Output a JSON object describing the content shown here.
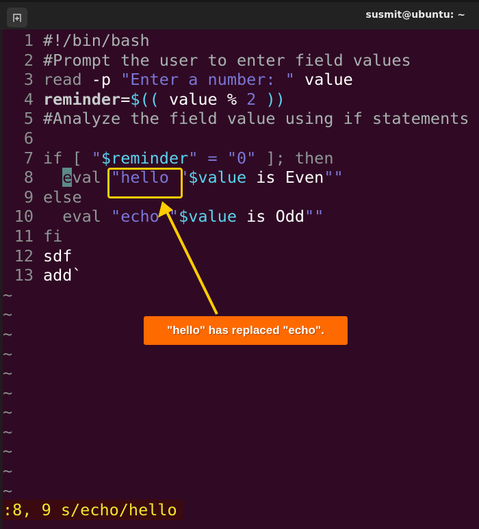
{
  "window": {
    "title": "susmit@ubuntu: ~",
    "new_tab_icon": "new-tab-icon"
  },
  "editor": {
    "lines": [
      {
        "n": "1",
        "segments": [
          {
            "t": "#!/bin/bash",
            "c": "comment"
          }
        ]
      },
      {
        "n": "2",
        "segments": [
          {
            "t": "#Prompt the user to enter field values",
            "c": "comment"
          }
        ]
      },
      {
        "n": "3",
        "segments": [
          {
            "t": "read ",
            "c": "kw"
          },
          {
            "t": "-p ",
            "c": "plain"
          },
          {
            "t": "\"Enter a number: \"",
            "c": "str"
          },
          {
            "t": " value",
            "c": "plain"
          }
        ]
      },
      {
        "n": "4",
        "segments": [
          {
            "t": "reminder",
            "c": "bold"
          },
          {
            "t": "=",
            "c": "op"
          },
          {
            "t": "$((",
            "c": "var"
          },
          {
            "t": " value % ",
            "c": "plain"
          },
          {
            "t": "2",
            "c": "num"
          },
          {
            "t": " ))",
            "c": "var"
          }
        ]
      },
      {
        "n": "5",
        "segments": [
          {
            "t": "#Analyze the field value using if statements",
            "c": "comment"
          }
        ]
      },
      {
        "n": "6",
        "segments": []
      },
      {
        "n": "7",
        "segments": [
          {
            "t": "if [ ",
            "c": "kw"
          },
          {
            "t": "\"",
            "c": "str"
          },
          {
            "t": "$reminder",
            "c": "var"
          },
          {
            "t": "\" = \"0\"",
            "c": "str"
          },
          {
            "t": " ]; then",
            "c": "kw"
          }
        ]
      },
      {
        "n": "8",
        "segments": [
          {
            "t": "  ",
            "c": "plain"
          },
          {
            "t": "e",
            "c": "cursor"
          },
          {
            "t": "val ",
            "c": "kw"
          },
          {
            "t": "\"hello \"",
            "c": "str"
          },
          {
            "t": "$value",
            "c": "var"
          },
          {
            "t": " is Even",
            "c": "plain"
          },
          {
            "t": "\"\"",
            "c": "str"
          }
        ]
      },
      {
        "n": "9",
        "segments": [
          {
            "t": "else",
            "c": "kw"
          }
        ]
      },
      {
        "n": "10",
        "segments": [
          {
            "t": "  eval ",
            "c": "kw"
          },
          {
            "t": "\"echo \"",
            "c": "str"
          },
          {
            "t": "$value",
            "c": "var"
          },
          {
            "t": " is Odd",
            "c": "plain"
          },
          {
            "t": "\"\"",
            "c": "str"
          }
        ]
      },
      {
        "n": "11",
        "segments": [
          {
            "t": "fi",
            "c": "kw"
          }
        ]
      },
      {
        "n": "12",
        "segments": [
          {
            "t": "sdf",
            "c": "plain"
          }
        ]
      },
      {
        "n": "13",
        "segments": [
          {
            "t": "add`",
            "c": "plain"
          }
        ]
      }
    ],
    "empty_line_marker": "~",
    "empty_line_count": 11
  },
  "command_line": ":8, 9 s/echo/hello",
  "annotation": {
    "callout_text": "\"hello\" has replaced \"echo\".",
    "highlight_color": "#ffcc00",
    "callout_color": "#ff6a00"
  }
}
